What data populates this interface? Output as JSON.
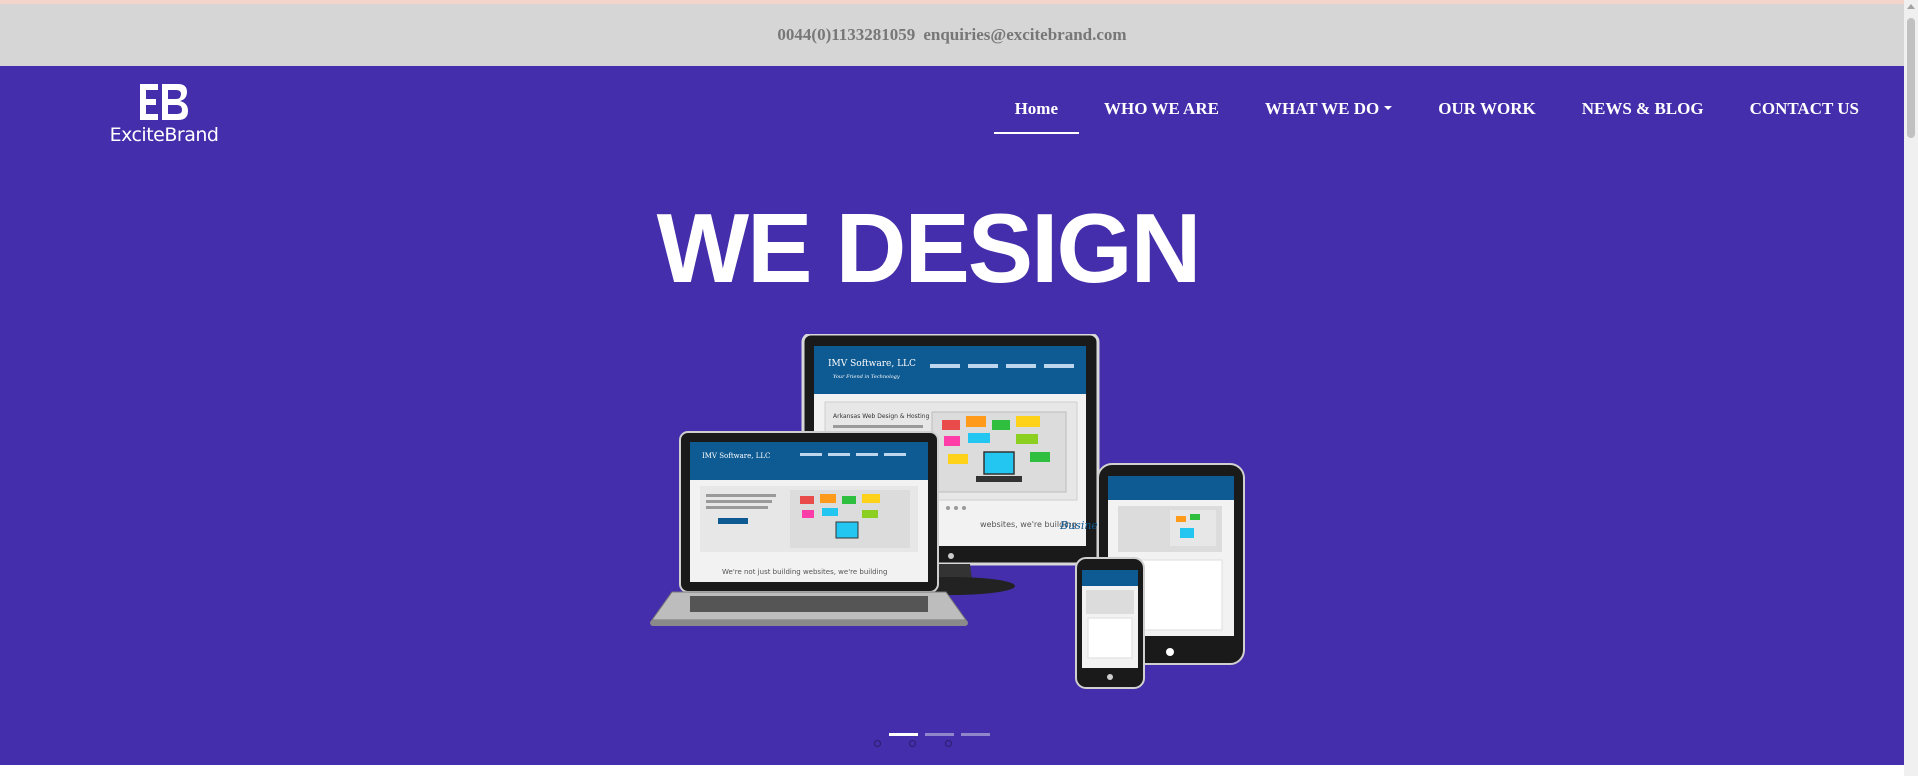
{
  "topbar": {
    "phone": "0044(0)1133281059",
    "email": "enquiries@excitebrand.com"
  },
  "logo": {
    "mark_icon": "eb-monogram-icon",
    "wordmark": "ExciteBrand"
  },
  "nav": {
    "items": [
      {
        "label": "Home",
        "active": true
      },
      {
        "label": "WHO WE ARE"
      },
      {
        "label": "WHAT WE DO",
        "dropdown": true
      },
      {
        "label": "OUR WORK"
      },
      {
        "label": "NEWS & BLOG"
      },
      {
        "label": "CONTACT US"
      }
    ]
  },
  "hero": {
    "headline": "WE DESIGN",
    "image_icon": "responsive-devices-illustration",
    "mockup": {
      "company": "IMV Software, LLC",
      "tagline": "Your Friend in Technology",
      "heading": "Arkansas Web Design & Hosting",
      "button": "LEARN MORE",
      "slogan": "We're not just building websites, we're building",
      "script": "Businesses"
    },
    "slides": {
      "count": 3,
      "active": 0
    }
  },
  "colors": {
    "hero_bg": "#442eab",
    "topbar_bg": "#d6d6d6",
    "topbar_text": "#777777",
    "nav_text": "#ffffff"
  }
}
